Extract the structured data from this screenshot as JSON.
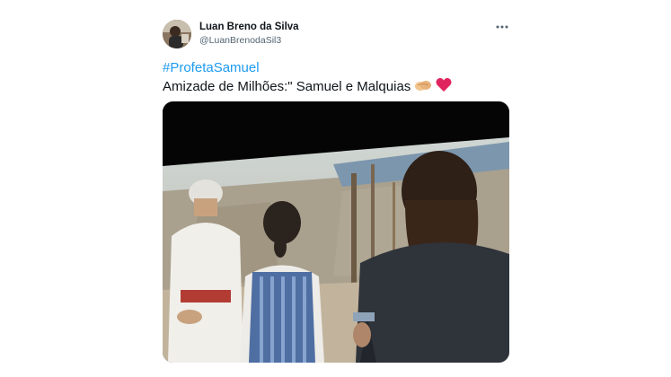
{
  "author": {
    "name": "Luan Breno da Silva",
    "handle": "@LuanBrenodaSil3",
    "avatar_icon": "profile-photo"
  },
  "menu": {
    "icon": "more-horizontal-icon"
  },
  "tweet": {
    "hashtag": "#ProfetaSamuel",
    "text": "Amizade de Milhões:\" Samuel e Malquias",
    "emojis": [
      "handshake-emoji",
      "red-heart-emoji"
    ]
  },
  "media": {
    "type": "photo",
    "description_icon": "tv-screen-photo"
  },
  "colors": {
    "link": "#1d9bf0",
    "text": "#0f1419",
    "secondary": "#536471",
    "heart": "#e0245e"
  }
}
